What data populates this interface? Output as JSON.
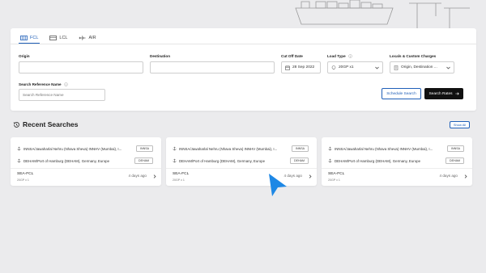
{
  "tabs": [
    {
      "label": "FCL",
      "icon": "container-icon",
      "active": true
    },
    {
      "label": "LCL",
      "icon": "box-icon",
      "active": false
    },
    {
      "label": "AIR",
      "icon": "plane-icon",
      "active": false
    }
  ],
  "form": {
    "origin_label": "Origin",
    "origin_value": "",
    "destination_label": "Destination",
    "destination_value": "",
    "cutoff_label": "Cut Off Date",
    "cutoff_value": "28 Sep 2022",
    "load_label": "Load Type",
    "load_value": "20GP x1",
    "charges_label": "Locals & Custom Charges",
    "charges_value": "Origin, Destination ...",
    "ref_label": "Search Reference Name",
    "ref_placeholder": "Search Reference Name",
    "schedule_btn": "Schedule Search",
    "rates_btn": "Search Rates"
  },
  "recent": {
    "title": "Recent Searches",
    "show_all": "Show All",
    "items": [
      {
        "origin": "INNSA/Jawaharlal Nehru (Nhava Sheva) INNHV (Mumbai), I...",
        "origin_code": "INNSA",
        "dest": "DEHAM/Port of Hamburg (DEHAM), Germany, Europe",
        "dest_code": "DEHAM",
        "type": "SEA-FCL",
        "load": "20GP x 1",
        "ago": "4 days ago"
      },
      {
        "origin": "INNSA/Jawaharlal Nehru (Nhava Sheva) INNHV (Mumbai), I...",
        "origin_code": "INNSA",
        "dest": "DEHAM/Port of Hamburg (DEHAM), Germany, Europe",
        "dest_code": "DEHAM",
        "type": "SEA-FCL",
        "load": "20GP x 1",
        "ago": "4 days ago"
      },
      {
        "origin": "INNSA/Jawaharlal Nehru (Nhava Sheva) INNHV (Mumbai), I...",
        "origin_code": "INNSA",
        "dest": "DEHAM/Port of Hamburg (DEHAM), Germany, Europe",
        "dest_code": "DEHAM",
        "type": "SEA-FCL",
        "load": "20GP x 1",
        "ago": "4 days ago"
      }
    ]
  },
  "colors": {
    "accent": "#1f5fb8",
    "dark_button": "#111111",
    "cursor": "#1e88e5"
  }
}
